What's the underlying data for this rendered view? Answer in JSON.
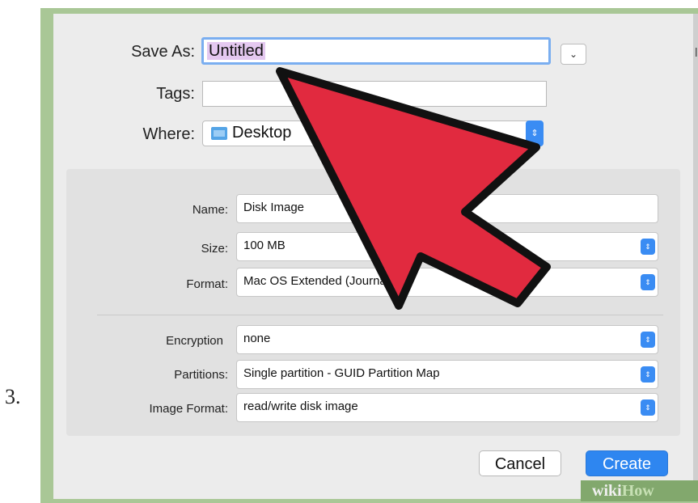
{
  "step_number": "3.",
  "dialog": {
    "save_as_label": "Save As:",
    "save_as_value": "Untitled",
    "tags_label": "Tags:",
    "tags_value": "",
    "where_label": "Where:",
    "where_value": "Desktop"
  },
  "settings": {
    "name_label": "Name:",
    "name_value": "Disk Image",
    "size_label": "Size:",
    "size_value": "100 MB",
    "format_label": "Format:",
    "format_value": "Mac OS Extended (Journaled)",
    "encryption_label": "Encryption",
    "encryption_value": "none",
    "partitions_label": "Partitions:",
    "partitions_value": "Single partition - GUID Partition Map",
    "image_format_label": "Image Format:",
    "image_format_value": "read/write disk image"
  },
  "buttons": {
    "cancel": "Cancel",
    "create": "Create"
  },
  "watermark": {
    "part1": "wiki",
    "part2": "How"
  },
  "colors": {
    "frame_green": "#a9c796",
    "accent_blue": "#3a8cf3",
    "arrow_red": "#e12a3f"
  },
  "icons": {
    "where_icon": "folder-icon",
    "stepper": "up-down-stepper-icon",
    "expand": "chevron-down-icon"
  }
}
